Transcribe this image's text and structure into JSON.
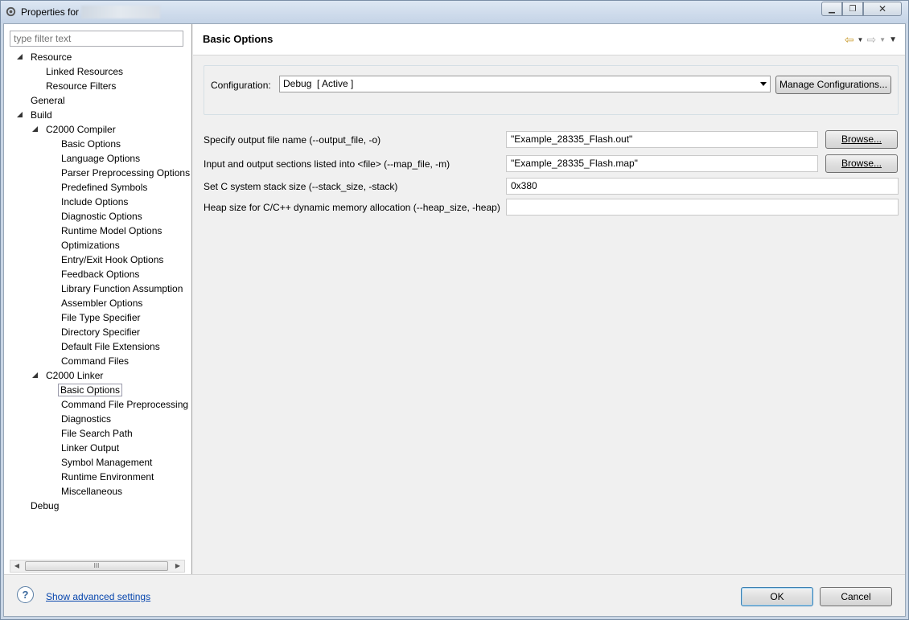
{
  "window": {
    "title": "Properties for"
  },
  "sidebar": {
    "filter_placeholder": "type filter text",
    "items": [
      {
        "label": "Resource"
      },
      {
        "label": "Linked Resources"
      },
      {
        "label": "Resource Filters"
      },
      {
        "label": "General"
      },
      {
        "label": "Build"
      },
      {
        "label": "C2000 Compiler"
      },
      {
        "label": "Basic Options"
      },
      {
        "label": "Language Options"
      },
      {
        "label": "Parser Preprocessing Options"
      },
      {
        "label": "Predefined Symbols"
      },
      {
        "label": "Include Options"
      },
      {
        "label": "Diagnostic Options"
      },
      {
        "label": "Runtime Model Options"
      },
      {
        "label": "Optimizations"
      },
      {
        "label": "Entry/Exit Hook Options"
      },
      {
        "label": "Feedback Options"
      },
      {
        "label": "Library Function Assumption"
      },
      {
        "label": "Assembler Options"
      },
      {
        "label": "File Type Specifier"
      },
      {
        "label": "Directory Specifier"
      },
      {
        "label": "Default File Extensions"
      },
      {
        "label": "Command Files"
      },
      {
        "label": "C2000 Linker"
      },
      {
        "label": "Basic Options"
      },
      {
        "label": "Command File Preprocessing"
      },
      {
        "label": "Diagnostics"
      },
      {
        "label": "File Search Path"
      },
      {
        "label": "Linker Output"
      },
      {
        "label": "Symbol Management"
      },
      {
        "label": "Runtime Environment"
      },
      {
        "label": "Miscellaneous"
      },
      {
        "label": "Debug"
      }
    ],
    "scroll_grip": "III"
  },
  "main": {
    "title": "Basic Options",
    "configuration": {
      "label": "Configuration:",
      "value": "Debug  [ Active ]",
      "manage_label": "Manage Configurations..."
    },
    "options": [
      {
        "label": "Specify output file name (--output_file, -o)",
        "value": "\"Example_28335_Flash.out\"",
        "button": "Browse..."
      },
      {
        "label": "Input and output sections listed into <file> (--map_file, -m)",
        "value": "\"Example_28335_Flash.map\"",
        "button": "Browse..."
      },
      {
        "label": "Set C system stack size (--stack_size, -stack)",
        "value": "0x380"
      },
      {
        "label": "Heap size for C/C++ dynamic memory allocation (--heap_size, -heap)",
        "value": ""
      }
    ]
  },
  "footer": {
    "help_icon": "?",
    "advanced_link": "Show advanced settings",
    "ok_label": "OK",
    "cancel_label": "Cancel"
  },
  "colors": {
    "link": "#0645ad",
    "nav_arrow": "#c89a2a"
  }
}
